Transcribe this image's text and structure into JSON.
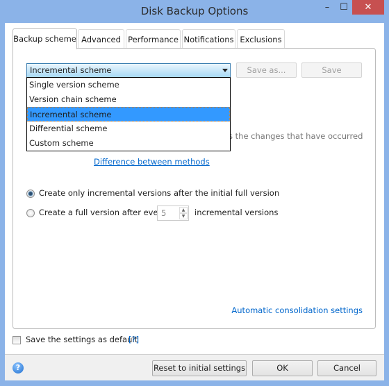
{
  "window": {
    "title": "Disk Backup Options",
    "minimize": "–",
    "maximize": "☐",
    "close": "✕"
  },
  "tabs": [
    {
      "label": "Backup scheme",
      "active": true
    },
    {
      "label": "Advanced"
    },
    {
      "label": "Performance"
    },
    {
      "label": "Notifications"
    },
    {
      "label": "Exclusions"
    }
  ],
  "scheme": {
    "selected": "Incremental scheme",
    "options": [
      "Single version scheme",
      "Version chain scheme",
      "Incremental scheme",
      "Differential scheme",
      "Custom scheme"
    ],
    "save_as": "Save as...",
    "save": "Save"
  },
  "description_visible": "s the changes that have occurred",
  "difference_link": "Difference between methods",
  "radios": [
    {
      "label": "Create only incremental versions after the initial full version",
      "checked": true
    },
    {
      "label": "Create a full version after every",
      "checked": false
    }
  ],
  "spinner": {
    "value": "5",
    "suffix": "incremental versions"
  },
  "consolidation_link": "Automatic consolidation settings",
  "save_default": {
    "label": "Save the settings as default",
    "checked": false,
    "help": "[?]"
  },
  "footer": {
    "reset": "Reset to initial settings",
    "ok": "OK",
    "cancel": "Cancel",
    "help_icon": "?"
  }
}
